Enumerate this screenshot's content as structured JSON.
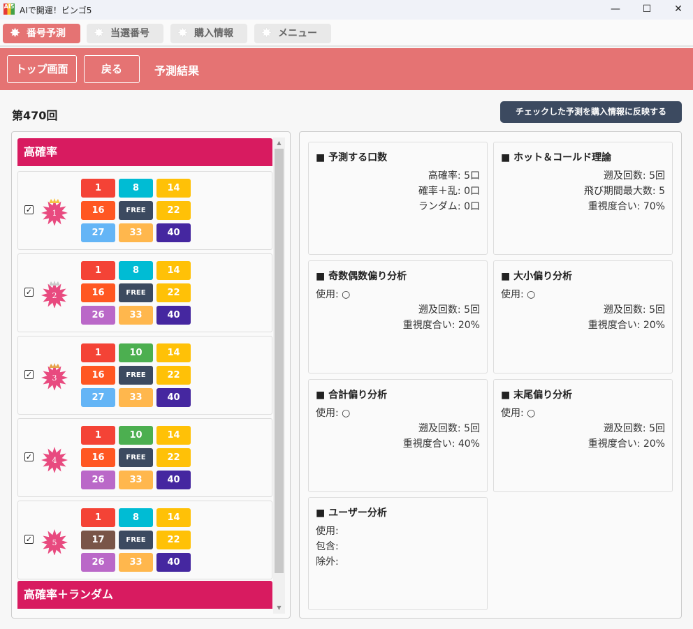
{
  "window": {
    "title": "AIで開運！ビンゴ5",
    "icon_text": "AI5",
    "minimize": "—",
    "maximize": "☐",
    "close": "✕"
  },
  "tabs": [
    {
      "label": "番号予測",
      "active": true
    },
    {
      "label": "当選番号",
      "active": false
    },
    {
      "label": "購入情報",
      "active": false
    },
    {
      "label": "メニュー",
      "active": false
    }
  ],
  "header": {
    "top_button": "トップ画面",
    "back_button": "戻る",
    "title": "予測結果"
  },
  "draw_number": "第470回",
  "apply_button": "チェックした予測を購入情報に反映する",
  "sections": [
    {
      "title": "高確率"
    },
    {
      "title": "高確率＋ランダム"
    }
  ],
  "predictions": [
    {
      "rank": "1",
      "crown": "gold",
      "checked": true,
      "numbers": [
        "1",
        "8",
        "14",
        "16",
        "FREE",
        "22",
        "27",
        "33",
        "40"
      ]
    },
    {
      "rank": "2",
      "crown": "silver",
      "checked": true,
      "numbers": [
        "1",
        "8",
        "14",
        "16",
        "FREE",
        "22",
        "26",
        "33",
        "40"
      ]
    },
    {
      "rank": "3",
      "crown": "bronze",
      "checked": true,
      "numbers": [
        "1",
        "10",
        "14",
        "16",
        "FREE",
        "22",
        "27",
        "33",
        "40"
      ]
    },
    {
      "rank": "4",
      "crown": "none",
      "checked": true,
      "numbers": [
        "1",
        "10",
        "14",
        "16",
        "FREE",
        "22",
        "26",
        "33",
        "40"
      ]
    },
    {
      "rank": "5",
      "crown": "none",
      "checked": true,
      "numbers": [
        "1",
        "8",
        "14",
        "17",
        "FREE",
        "22",
        "26",
        "33",
        "40"
      ]
    }
  ],
  "number_colors": {
    "1": "#f44336",
    "8": "#00bcd4",
    "10": "#4caf50",
    "14": "#ffc107",
    "16": "#ff5722",
    "17": "#795548",
    "FREE": "#3c4a60",
    "22": "#ffc107",
    "26": "#ba68c8",
    "27": "#64b5f6",
    "33": "#ffb74d",
    "40": "#4527a0"
  },
  "info_cards": [
    {
      "title": "■ 予測する口数",
      "lines": [
        {
          "text": "高確率: 5口",
          "align": "r"
        },
        {
          "text": "確率＋乱: 0口",
          "align": "r"
        },
        {
          "text": "ランダム: 0口",
          "align": "r"
        }
      ]
    },
    {
      "title": "■ ホット＆コールド理論",
      "lines": [
        {
          "text": "遡及回数: 5回",
          "align": "r"
        },
        {
          "text": "飛び期間最大数: 5",
          "align": "r"
        },
        {
          "text": "重視度合い: 70%",
          "align": "r"
        }
      ]
    },
    {
      "title": "■ 奇数偶数偏り分析",
      "lines": [
        {
          "text": "使用: ○",
          "align": "l"
        },
        {
          "text": "遡及回数: 5回",
          "align": "r"
        },
        {
          "text": "重視度合い: 20%",
          "align": "r"
        }
      ]
    },
    {
      "title": "■ 大小偏り分析",
      "lines": [
        {
          "text": "使用: ○",
          "align": "l"
        },
        {
          "text": "遡及回数: 5回",
          "align": "r"
        },
        {
          "text": "重視度合い: 20%",
          "align": "r"
        }
      ]
    },
    {
      "title": "■ 合計偏り分析",
      "lines": [
        {
          "text": "使用: ○",
          "align": "l"
        },
        {
          "text": "遡及回数: 5回",
          "align": "r"
        },
        {
          "text": "重視度合い: 40%",
          "align": "r"
        }
      ]
    },
    {
      "title": "■ 末尾偏り分析",
      "lines": [
        {
          "text": "使用: ○",
          "align": "l"
        },
        {
          "text": "遡及回数: 5回",
          "align": "r"
        },
        {
          "text": "重視度合い: 20%",
          "align": "r"
        }
      ]
    },
    {
      "title": "■ ユーザー分析",
      "lines": [
        {
          "text": "使用:",
          "align": "l"
        },
        {
          "text": "包含:",
          "align": "l"
        },
        {
          "text": "除外:",
          "align": "l"
        }
      ]
    }
  ],
  "colors": {
    "accent": "#e57373",
    "section": "#d81b60",
    "dark_button": "#3c4a60"
  }
}
